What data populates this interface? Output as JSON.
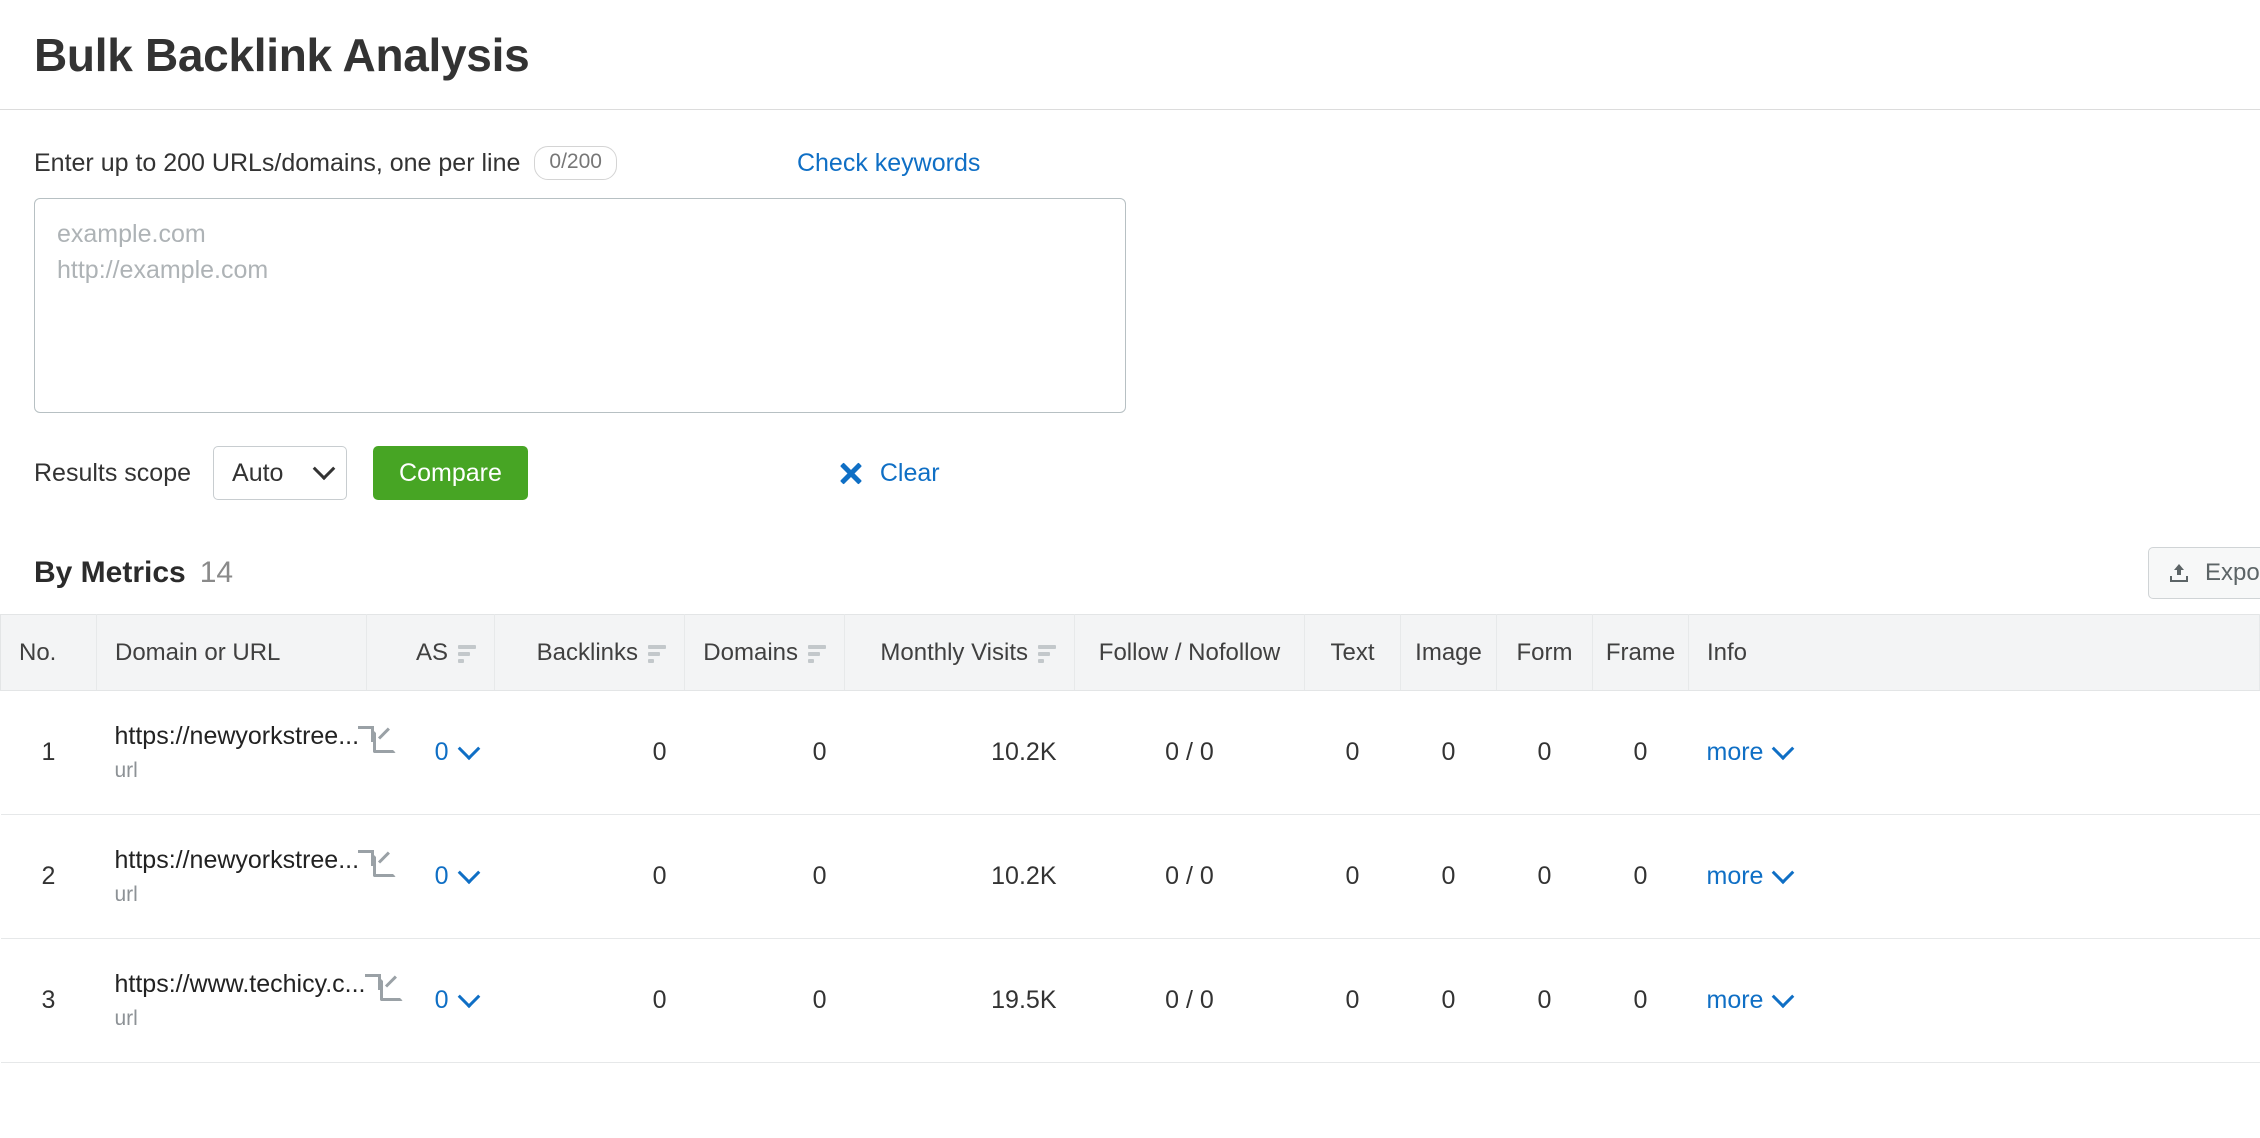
{
  "page": {
    "title": "Bulk Backlink Analysis"
  },
  "form": {
    "input_label": "Enter up to 200 URLs/domains, one per line",
    "counter": "0/200",
    "check_keywords_label": "Check keywords",
    "textarea_placeholder": "example.com\nhttp://example.com",
    "textarea_value": "",
    "scope_label": "Results scope",
    "scope_value": "Auto",
    "scope_chevron_icon": "chevron-down-icon",
    "compare_label": "Compare",
    "clear_label": "Clear",
    "clear_icon": "close-x-icon"
  },
  "results": {
    "title": "By Metrics",
    "count": "14",
    "export_label": "Export",
    "export_icon": "upload-icon",
    "columns": [
      {
        "label": "No.",
        "align": "left",
        "sortable": false
      },
      {
        "label": "Domain or URL",
        "align": "left",
        "sortable": false
      },
      {
        "label": "AS",
        "align": "right",
        "sortable": true
      },
      {
        "label": "Backlinks",
        "align": "right",
        "sortable": true
      },
      {
        "label": "Domains",
        "align": "right",
        "sortable": true
      },
      {
        "label": "Monthly Visits",
        "align": "right",
        "sortable": true
      },
      {
        "label": "Follow / Nofollow",
        "align": "center",
        "sortable": false
      },
      {
        "label": "Text",
        "align": "center",
        "sortable": false
      },
      {
        "label": "Image",
        "align": "center",
        "sortable": false
      },
      {
        "label": "Form",
        "align": "center",
        "sortable": false
      },
      {
        "label": "Frame",
        "align": "center",
        "sortable": false
      },
      {
        "label": "Info",
        "align": "left",
        "sortable": false
      }
    ],
    "rows": [
      {
        "no": "1",
        "domain": "https://newyorkstree...",
        "domain_type": "url",
        "as": "0",
        "backlinks": "0",
        "domains": "0",
        "monthly_visits": "10.2K",
        "follow_nofollow": "0 / 0",
        "text": "0",
        "image": "0",
        "form": "0",
        "frame": "0",
        "info": "more"
      },
      {
        "no": "2",
        "domain": "https://newyorkstree...",
        "domain_type": "url",
        "as": "0",
        "backlinks": "0",
        "domains": "0",
        "monthly_visits": "10.2K",
        "follow_nofollow": "0 / 0",
        "text": "0",
        "image": "0",
        "form": "0",
        "frame": "0",
        "info": "more"
      },
      {
        "no": "3",
        "domain": "https://www.techicy.c...",
        "domain_type": "url",
        "as": "0",
        "backlinks": "0",
        "domains": "0",
        "monthly_visits": "19.5K",
        "follow_nofollow": "0 / 0",
        "text": "0",
        "image": "0",
        "form": "0",
        "frame": "0",
        "info": "more"
      }
    ]
  },
  "colors": {
    "link": "#0f6fc5",
    "primary_button": "#47a524",
    "header_bg": "#f3f4f5",
    "muted_text": "#8d9296"
  }
}
